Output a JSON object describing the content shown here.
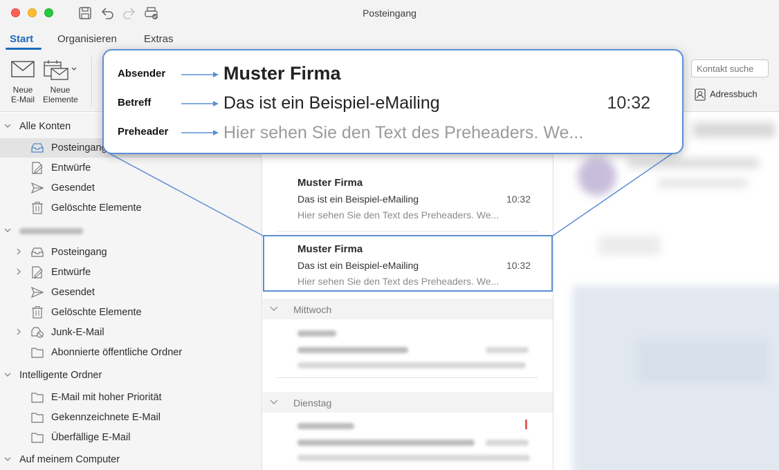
{
  "window": {
    "title": "Posteingang"
  },
  "tabs": [
    {
      "label": "Start",
      "active": true
    },
    {
      "label": "Organisieren",
      "active": false
    },
    {
      "label": "Extras",
      "active": false
    }
  ],
  "ribbon": {
    "new_email": "Neue\nE-Mail",
    "new_email_l1": "Neue",
    "new_email_l2": "E-Mail",
    "new_items_l1": "Neue",
    "new_items_l2": "Elemente",
    "contact_search_placeholder": "Kontakt suche",
    "address_book": "Adressbuch"
  },
  "sidebar": {
    "groups": [
      {
        "label": "Alle Konten"
      },
      {
        "label": "Intelligente Ordner"
      },
      {
        "label": "Auf meinem Computer"
      }
    ],
    "all_accounts": [
      {
        "label": "Posteingang",
        "icon": "inbox-icon",
        "selected": true
      },
      {
        "label": "Entwürfe",
        "icon": "draft-icon"
      },
      {
        "label": "Gesendet",
        "icon": "sent-icon"
      },
      {
        "label": "Gelöschte Elemente",
        "icon": "trash-icon"
      }
    ],
    "account2": [
      {
        "label": "Posteingang",
        "icon": "inbox-icon"
      },
      {
        "label": "Entwürfe",
        "icon": "draft-icon"
      },
      {
        "label": "Gesendet",
        "icon": "sent-icon"
      },
      {
        "label": "Gelöschte Elemente",
        "icon": "trash-icon"
      },
      {
        "label": "Junk-E-Mail",
        "icon": "junk-icon"
      },
      {
        "label": "Abonnierte öffentliche Ordner",
        "icon": "folder-icon"
      }
    ],
    "smart_folders": [
      {
        "label": "E-Mail mit hoher Priorität",
        "icon": "folder-icon"
      },
      {
        "label": "Gekennzeichnete E-Mail",
        "icon": "folder-icon"
      },
      {
        "label": "Überfällige E-Mail",
        "icon": "folder-icon"
      }
    ]
  },
  "messages": {
    "groups": [
      {
        "label": "Mittwoch"
      },
      {
        "label": "Dienstag"
      }
    ],
    "items": [
      {
        "sender": "Muster Firma",
        "subject": "Das ist ein Beispiel-eMailing",
        "time": "10:32",
        "preheader": "Hier sehen Sie den Text des Preheaders. We..."
      },
      {
        "sender": "Muster Firma",
        "subject": "Das ist ein Beispiel-eMailing",
        "time": "10:32",
        "preheader": "Hier sehen Sie den Text des Preheaders. We..."
      }
    ]
  },
  "callout": {
    "label_sender": "Absender",
    "label_subject": "Betreff",
    "label_preheader": "Preheader",
    "sender": "Muster Firma",
    "subject": "Das ist ein Beispiel-eMailing",
    "time": "10:32",
    "preheader": "Hier sehen Sie den Text des Preheaders. We...",
    "accent_color": "#5b8fd4"
  }
}
